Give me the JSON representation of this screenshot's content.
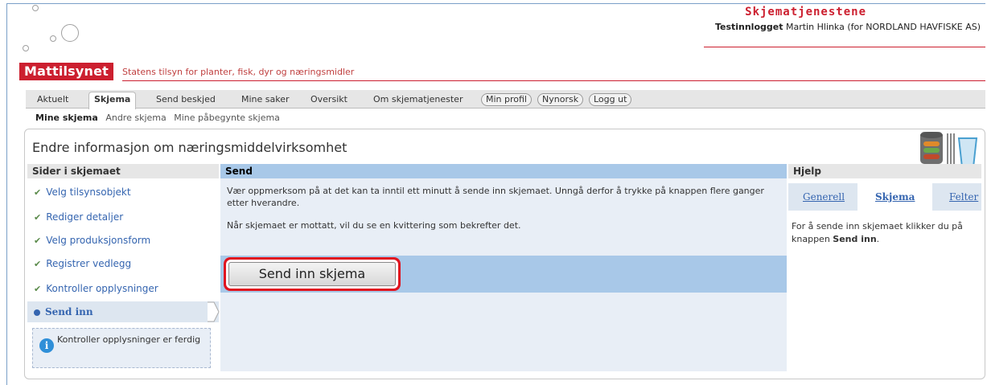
{
  "header": {
    "logo_text": "Mattilsynet",
    "tagline": "Statens tilsyn for planter, fisk, dyr og næringsmidler",
    "brand_title": "Skjematjenestene",
    "login_label": "Testinnlogget",
    "login_user": "Martin Hlinka (for NORDLAND HAVFISKE AS)"
  },
  "nav": {
    "tabs": [
      "Aktuelt",
      "Skjema",
      "Send beskjed",
      "Mine saker",
      "Oversikt",
      "Om skjematjenester"
    ],
    "pills": [
      "Min profil",
      "Nynorsk",
      "Logg ut"
    ],
    "active": "Skjema"
  },
  "subnav": [
    "Mine skjema",
    "Andre skjema",
    "Mine påbegynte skjema"
  ],
  "page_title": "Endre informasjon om næringsmiddelvirksomhet",
  "left": {
    "heading": "Sider i skjemaet",
    "steps": [
      "Velg tilsynsobjekt",
      "Rediger detaljer",
      "Velg produksjonsform",
      "Registrer vedlegg",
      "Kontroller opplysninger"
    ],
    "active_step": "Send inn",
    "info": "Kontroller opplysninger er ferdig"
  },
  "main": {
    "heading": "Send",
    "notice": "Vær oppmerksom på at det kan ta inntil ett minutt å sende inn skjemaet. Unngå derfor å trykke på knappen flere ganger etter hverandre.",
    "receipt": "Når skjemaet er mottatt, vil du se en kvittering som bekrefter det.",
    "send_button": "Send inn skjema"
  },
  "help": {
    "heading": "Hjelp",
    "tabs": [
      "Generell",
      "Skjema",
      "Felter"
    ],
    "active_tab": "Skjema",
    "text_before": "For å sende inn skjemaet klikker du på knappen ",
    "text_bold": "Send inn",
    "text_after": "."
  },
  "colors": {
    "brand_red": "#cc1f2f",
    "link_blue": "#3565b0",
    "panel_blue": "#a8c8e8",
    "highlight_red": "#e0141f"
  }
}
